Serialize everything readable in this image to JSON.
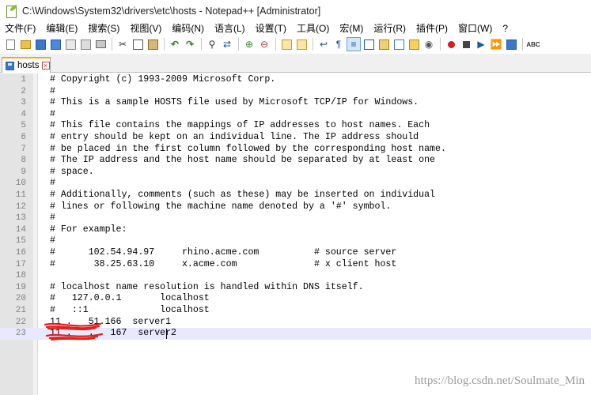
{
  "window": {
    "title": "C:\\Windows\\System32\\drivers\\etc\\hosts - Notepad++ [Administrator]"
  },
  "menu": [
    "文件(F)",
    "编辑(E)",
    "搜索(S)",
    "视图(V)",
    "编码(N)",
    "语言(L)",
    "设置(T)",
    "工具(O)",
    "宏(M)",
    "运行(R)",
    "插件(P)",
    "窗口(W)",
    "?"
  ],
  "toolbar_icons": [
    "new-file",
    "open-file",
    "save",
    "save-all",
    "close",
    "close-all",
    "print",
    "cut",
    "copy",
    "paste",
    "undo",
    "redo",
    "find",
    "replace",
    "zoom-in",
    "zoom-out",
    "sync-vertical",
    "sync-horizontal",
    "word-wrap",
    "show-all-chars",
    "indent-guide",
    "user-language",
    "document-map",
    "function-list",
    "folder-workspace",
    "monitoring",
    "record-macro",
    "stop-record",
    "play-macro",
    "run-macro-multiple",
    "save-macro",
    "spell-check"
  ],
  "tab": {
    "label": "hosts"
  },
  "lines": [
    {
      "n": "1",
      "text": "# Copyright (c) 1993-2009 Microsoft Corp."
    },
    {
      "n": "2",
      "text": "#"
    },
    {
      "n": "3",
      "text": "# This is a sample HOSTS file used by Microsoft TCP/IP for Windows."
    },
    {
      "n": "4",
      "text": "#"
    },
    {
      "n": "5",
      "text": "# This file contains the mappings of IP addresses to host names. Each"
    },
    {
      "n": "6",
      "text": "# entry should be kept on an individual line. The IP address should"
    },
    {
      "n": "7",
      "text": "# be placed in the first column followed by the corresponding host name."
    },
    {
      "n": "8",
      "text": "# The IP address and the host name should be separated by at least one"
    },
    {
      "n": "9",
      "text": "# space."
    },
    {
      "n": "10",
      "text": "#"
    },
    {
      "n": "11",
      "text": "# Additionally, comments (such as these) may be inserted on individual"
    },
    {
      "n": "12",
      "text": "# lines or following the machine name denoted by a '#' symbol."
    },
    {
      "n": "13",
      "text": "#"
    },
    {
      "n": "14",
      "text": "# For example:"
    },
    {
      "n": "15",
      "text": "#"
    },
    {
      "n": "16",
      "text": "#      102.54.94.97     rhino.acme.com          # source server"
    },
    {
      "n": "17",
      "text": "#       38.25.63.10     x.acme.com              # x client host"
    },
    {
      "n": "18",
      "text": ""
    },
    {
      "n": "19",
      "text": "# localhost name resolution is handled within DNS itself."
    },
    {
      "n": "20",
      "text": "#   127.0.0.1       localhost"
    },
    {
      "n": "21",
      "text": "#   ::1             localhost"
    },
    {
      "n": "22",
      "text": "11 .   51.166  server1"
    },
    {
      "n": "23",
      "text": "11 .   .   167  server2"
    }
  ],
  "watermark": "https://blog.csdn.net/Soulmate_Min",
  "colors": {
    "line_number": "#808080",
    "current_line": "#e8e8ff",
    "redaction": "#e0201c",
    "tab_accent": "#f5a623"
  }
}
